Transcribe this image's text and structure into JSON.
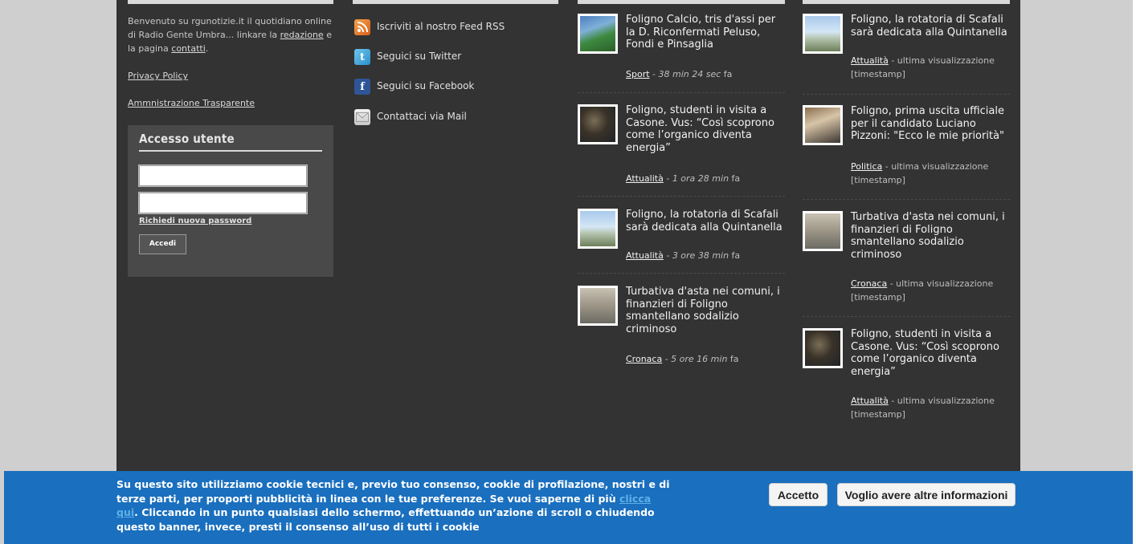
{
  "about": {
    "intro_1": "Benvenuto su rgunotizie.it il quotidiano online di Radio Gente Umbra... linkare la ",
    "redazione": "redazione",
    "intro_2": " e la pagina ",
    "contatti": "contatti",
    "intro_3": ".",
    "privacy": "Privacy Policy",
    "trasparente": "Ammnistrazione Trasparente"
  },
  "login": {
    "title": "Accesso utente",
    "username_value": "",
    "password_value": "",
    "forgot": "Richiedi nuova password",
    "submit": "Accedi"
  },
  "social": [
    {
      "label": "Iscriviti al nostro Feed RSS",
      "icon": "rss-icon"
    },
    {
      "label": "Seguici su Twitter",
      "icon": "twitter-icon"
    },
    {
      "label": "Seguici su Facebook",
      "icon": "facebook-icon"
    },
    {
      "label": "Contattaci via Mail",
      "icon": "mail-icon"
    }
  ],
  "latest": [
    {
      "title": "Foligno Calcio, tris d'assi per la D. Riconfermati Peluso, Fondi e Pinsaglia",
      "category": "Sport",
      "time": "38 min 24 sec",
      "suffix": " fa"
    },
    {
      "title": "Foligno, studenti in visita a Casone. Vus: “Così scoprono come l’organico diventa energia”",
      "category": "Attualità",
      "time": "1 ora 28 min",
      "suffix": " fa"
    },
    {
      "title": "Foligno, la rotatoria di Scafali sarà dedicata alla Quintanella",
      "category": "Attualità",
      "time": "3 ore 38 min",
      "suffix": " fa"
    },
    {
      "title": "Turbativa d'asta nei comuni, i finanzieri di Foligno smantellano sodalizio criminoso",
      "category": "Cronaca",
      "time": "5 ore 16 min",
      "suffix": " fa"
    }
  ],
  "popular": [
    {
      "title": "Foligno, la rotatoria di Scafali sarà dedicata alla Quintanella",
      "category": "Attualità",
      "meta": " - ultima visualizzazione [timestamp]"
    },
    {
      "title": "Foligno, prima uscita ufficiale per il candidato Luciano Pizzoni: \"Ecco le mie priorità\"",
      "category": "Politica",
      "meta": " - ultima visualizzazione [timestamp]"
    },
    {
      "title": "Turbativa d'asta nei comuni, i finanzieri di Foligno smantellano sodalizio criminoso",
      "category": "Cronaca",
      "meta": " - ultima visualizzazione [timestamp]"
    },
    {
      "title": "Foligno, studenti in visita a Casone. Vus: “Così scoprono come l’organico diventa energia”",
      "category": "Attualità",
      "meta": " - ultima visualizzazione [timestamp]"
    }
  ],
  "cookie": {
    "text_1": "Su questo sito utilizziamo cookie tecnici e, previo tuo consenso, cookie di profilazione, nostri e di terze parti, per proporti pubblicità in linea con le tue preferenze. Se vuoi saperne di più ",
    "link": "clicca qui",
    "text_2": ". Cliccando in un punto qualsiasi dello schermo, effettuando un’azione di scroll o chiudendo questo banner, invece, presti il consenso all’uso di tutti i cookie",
    "accept": "Accetto",
    "more": "Voglio avere altre informazioni"
  },
  "colors": {
    "footer_bg": "#333333",
    "banner_bg": "#1a6fbe",
    "page_bg": "#cfcfcf"
  }
}
